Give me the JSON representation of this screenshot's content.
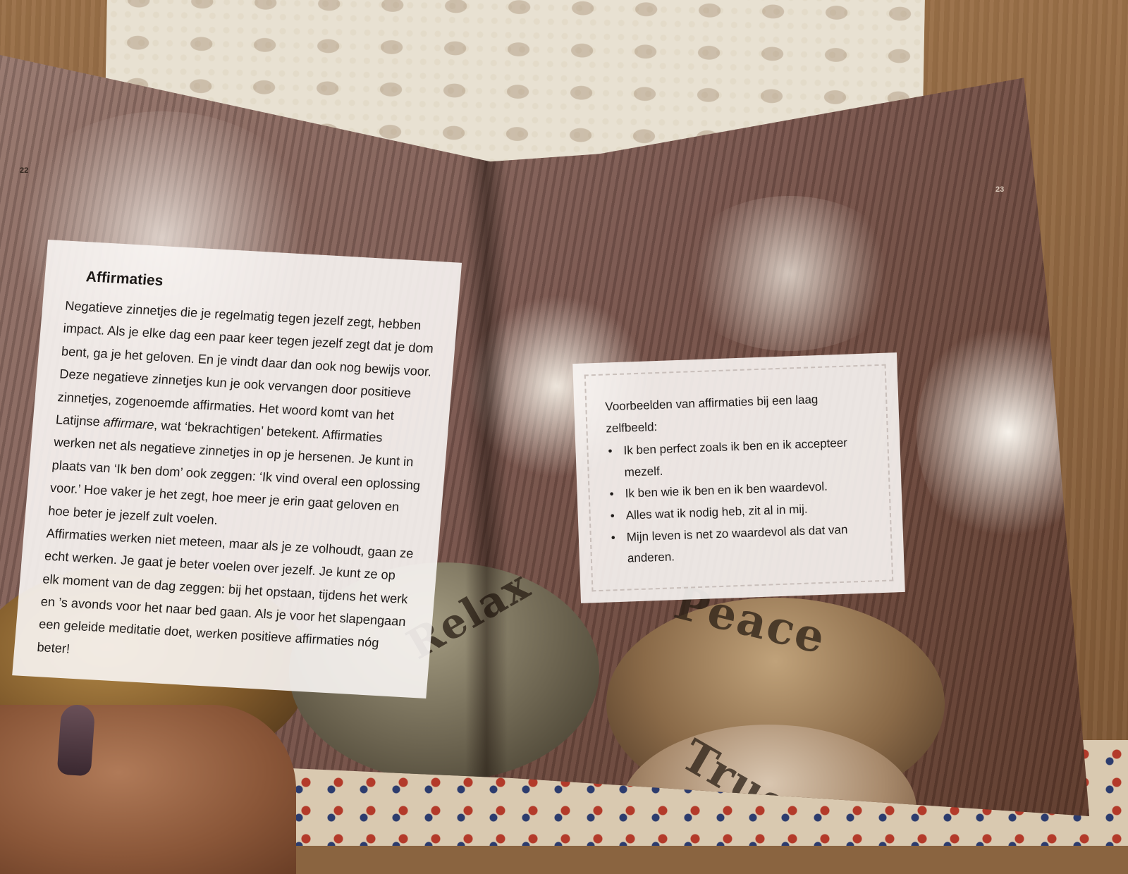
{
  "page_numbers": {
    "left": "22",
    "right": "23"
  },
  "left_box": {
    "title": "Affirmaties",
    "paragraph1_part1": "Negatieve zinnetjes die je regelmatig tegen jezelf zegt, hebben impact. Als je elke dag een paar keer tegen jezelf zegt dat je dom bent, ga je het geloven. En je vindt daar dan ook nog bewijs voor. Deze negatieve zinnetjes kun je ook vervangen door positieve zinnetjes, zogenoemde affirmaties. Het woord komt van het Latijnse ",
    "paragraph1_emphasis": "affirmare",
    "paragraph1_part2": ", wat ‘bekrachtigen’ betekent. Affirmaties werken net als negatieve zinnetjes in op je hersenen. Je kunt in plaats van ‘Ik ben dom’ ook zeggen: ‘Ik vind overal een oplossing voor.’ Hoe vaker je het zegt, hoe meer je erin gaat geloven en hoe beter je jezelf zult voelen.",
    "paragraph2": "Affirmaties werken niet meteen, maar als je ze volhoudt, gaan ze echt werken. Je gaat je beter voelen over jezelf. Je kunt ze op elk moment van de dag zeggen: bij het opstaan, tijdens het werk en ’s avonds voor het naar bed gaan. Als je voor het slapengaan een geleide meditatie doet, werken positieve affirmaties nóg beter!"
  },
  "right_box": {
    "intro": "Voorbeelden van affirmaties bij een laag zelfbeeld:",
    "bullet_symbol": "•",
    "items": [
      "Ik ben perfect zoals ik ben en ik accepteer mezelf.",
      "Ik ben wie ik ben en ik ben waardevol.",
      "Alles wat ik nodig heb, zit al in mij.",
      "Mijn leven is net zo waardevol als dat van anderen."
    ]
  },
  "stone_words": {
    "relax": "Relax",
    "peace": "Peace",
    "trust": "Trust"
  },
  "colors": {
    "page_photo": "#7a5a54",
    "text_box": "#f8f5f3",
    "text": "#1e1a18"
  }
}
